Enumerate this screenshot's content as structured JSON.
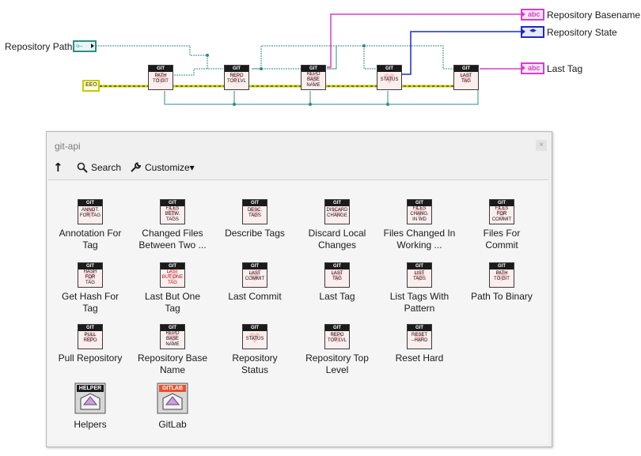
{
  "diagram": {
    "inputs": {
      "repository_path": "Repository Path"
    },
    "outputs": {
      "repository_basename": "Repository Basename",
      "repository_state": "Repository State",
      "last_tag": "Last Tag"
    },
    "terminal_glyphs": {
      "path": "⟜",
      "string": "abc",
      "enum": "◂▸",
      "error": "EEO"
    },
    "nodes": [
      {
        "header": "GIT",
        "text": "PATH\nTO GIT"
      },
      {
        "header": "GIT",
        "text": "REPO\nTOP LVL"
      },
      {
        "header": "GIT",
        "text": "REPO\nBASE\nNAME"
      },
      {
        "header": "GIT",
        "text": "STATUS"
      },
      {
        "header": "GIT",
        "text": "LAST\nTAG"
      }
    ],
    "colors": {
      "path_wire": "#2d8d86",
      "string_wire": "#d63fc8",
      "enum_wire": "#1d28c8",
      "error_wire": "#c8c800"
    }
  },
  "palette": {
    "title": "git-api",
    "close_label": "×",
    "toolbar": {
      "up_icon": "↑",
      "search_label": "Search",
      "customize_label": "Customize▾"
    },
    "items": [
      {
        "icon_header": "GIT",
        "icon_text": "ANNOT.\nFOR TAG",
        "label": "Annotation For\nTag"
      },
      {
        "icon_header": "GIT",
        "icon_text": "FILES\nBETW.\nTAGS",
        "label": "Changed Files\nBetween Two ..."
      },
      {
        "icon_header": "GIT",
        "icon_text": "DESC.\nTAGS",
        "label": "Describe Tags"
      },
      {
        "icon_header": "GIT",
        "icon_text": "DISCARD\nCHANGE",
        "label": "Discard Local\nChanges"
      },
      {
        "icon_header": "GIT",
        "icon_text": "FILES\nCHANG.\nIN WD",
        "label": "Files Changed In\nWorking ..."
      },
      {
        "icon_header": "GIT",
        "icon_text": "FILES\nFOR\nCOMMIT",
        "label": "Files For\nCommit"
      },
      {
        "icon_header": "GIT",
        "icon_text": "HASH\nFOR\nTAG",
        "label": "Get Hash For\nTag"
      },
      {
        "icon_header": "GIT",
        "icon_text": "LAST\nBUT ONE\nTAG",
        "label": "Last But One\nTag"
      },
      {
        "icon_header": "GIT",
        "icon_text": "LAST\nCOMMIT",
        "label": "Last Commit"
      },
      {
        "icon_header": "GIT",
        "icon_text": "LAST\nTAG",
        "label": "Last Tag"
      },
      {
        "icon_header": "GIT",
        "icon_text": "LIST\nTAGS",
        "label": "List Tags With\nPattern"
      },
      {
        "icon_header": "GIT",
        "icon_text": "PATH\nTO GIT",
        "label": "Path To Binary"
      },
      {
        "icon_header": "GIT",
        "icon_text": "PULL\nREPO",
        "label": "Pull Repository"
      },
      {
        "icon_header": "GIT",
        "icon_text": "REPO\nBASE\nNAME",
        "label": "Repository Base\nName"
      },
      {
        "icon_header": "GIT",
        "icon_text": "STATUS",
        "label": "Repository\nStatus"
      },
      {
        "icon_header": "GIT",
        "icon_text": "REPO\nTOP LVL",
        "label": "Repository Top\nLevel"
      },
      {
        "icon_header": "GIT",
        "icon_text": "RESET\n--HARD",
        "label": "Reset Hard"
      }
    ],
    "folders": [
      {
        "tag": "HELPER",
        "label": "Helpers",
        "tag_color": "#1b1b1b"
      },
      {
        "tag": "GITLAB",
        "label": "GitLab",
        "tag_color": "#e8532b"
      }
    ]
  }
}
